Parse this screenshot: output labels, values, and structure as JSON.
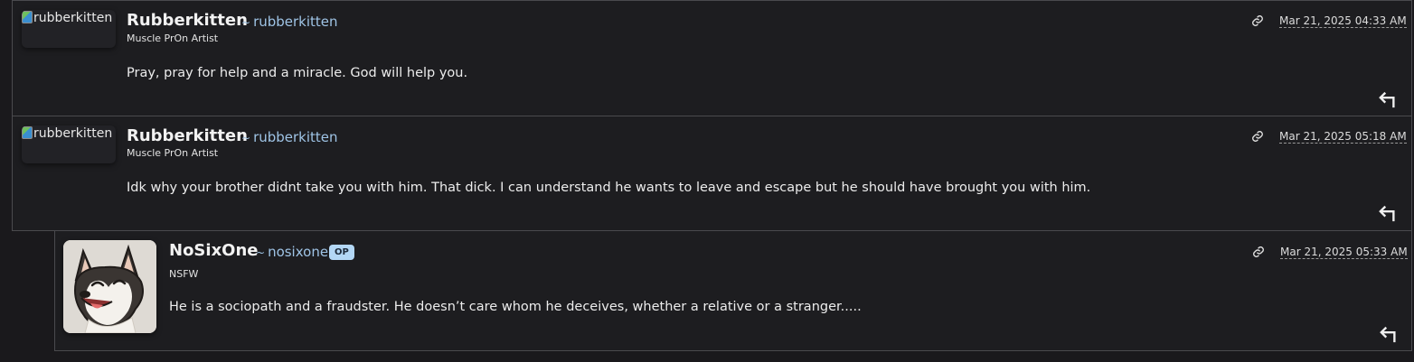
{
  "comments": [
    {
      "avatar_alt": "rubberkitten",
      "author": "Rubberkitten",
      "handle": "rubberkitten",
      "flair": "Muscle PrOn Artist",
      "body": "Pray, pray for help and a miracle. God will help you.",
      "timestamp": "Mar 21, 2025 04:33 AM",
      "link_icon": "link-icon",
      "reply_icon": "reply-icon"
    },
    {
      "avatar_alt": "rubberkitten",
      "author": "Rubberkitten",
      "handle": "rubberkitten",
      "flair": "Muscle PrOn Artist",
      "body": "Idk why your brother didnt take you with him. That dick. I can understand he wants to leave and escape but he should have brought you with him.",
      "timestamp": "Mar 21, 2025 05:18 AM",
      "link_icon": "link-icon",
      "reply_icon": "reply-icon"
    },
    {
      "avatar_alt": "husky dog avatar",
      "author": "NoSixOne",
      "handle": "nosixone",
      "badge": "OP",
      "flair": "NSFW",
      "body": "He is a sociopath and a fraudster. He doesn’t care whom he deceives, whether a relative or a stranger.....",
      "timestamp": "Mar 21, 2025 05:33 AM",
      "link_icon": "link-icon",
      "reply_icon": "reply-icon"
    }
  ],
  "colors": {
    "background": "#1a191c",
    "card": "#1d1d20",
    "border": "#4a4a4e",
    "handle": "#9fc4e6",
    "op_badge": "#b3d7f5"
  }
}
